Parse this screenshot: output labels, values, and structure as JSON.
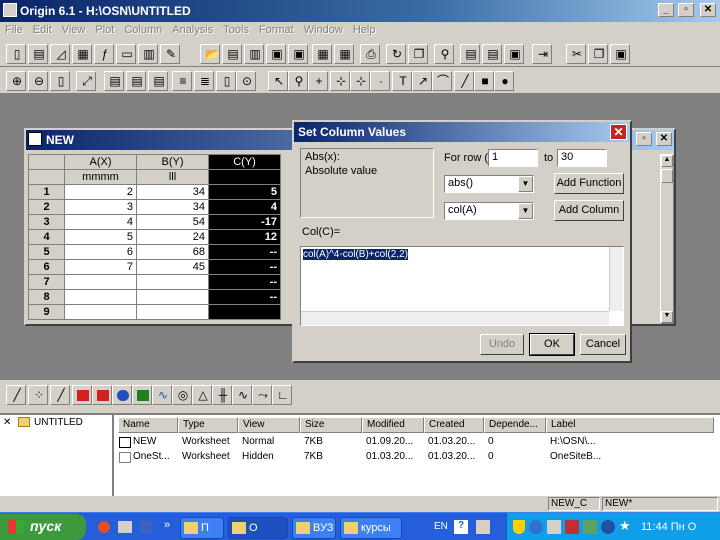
{
  "window": {
    "title": "Origin 6.1 - H:\\OSN\\UNTITLED"
  },
  "menu": [
    "File",
    "Edit",
    "View",
    "Plot",
    "Column",
    "Analysis",
    "Tools",
    "Format",
    "Window",
    "Help"
  ],
  "worksheet": {
    "title": "NEW",
    "columns": [
      {
        "name": "A(X)",
        "sub": "mmmm"
      },
      {
        "name": "B(Y)",
        "sub": "lll"
      },
      {
        "name": "C(Y)",
        "sub": ""
      }
    ],
    "rows": [
      {
        "n": "1",
        "a": "2",
        "b": "34",
        "c": "5"
      },
      {
        "n": "2",
        "a": "3",
        "b": "34",
        "c": "4"
      },
      {
        "n": "3",
        "a": "4",
        "b": "54",
        "c": "-17"
      },
      {
        "n": "4",
        "a": "5",
        "b": "24",
        "c": "12"
      },
      {
        "n": "5",
        "a": "6",
        "b": "68",
        "c": "--"
      },
      {
        "n": "6",
        "a": "7",
        "b": "45",
        "c": "--"
      },
      {
        "n": "7",
        "a": "",
        "b": "",
        "c": "--"
      },
      {
        "n": "8",
        "a": "",
        "b": "",
        "c": "--"
      },
      {
        "n": "9",
        "a": "",
        "b": "",
        "c": ""
      }
    ]
  },
  "dialog": {
    "title": "Set Column Values",
    "func_name": "Abs(x):",
    "func_desc": "Absolute value",
    "for_row_label": "For row (i)",
    "from_value": "1",
    "to_label": "to",
    "to_value": "30",
    "func_select": "abs()",
    "col_select": "col(A)",
    "add_function": "Add Function",
    "add_column": "Add Column",
    "col_label": "Col(C)=",
    "formula": "col(A)^4-col(B)+col(2,2)",
    "undo": "Undo",
    "ok": "OK",
    "cancel": "Cancel"
  },
  "explorer": {
    "folder": "UNTITLED",
    "headers": [
      "Name",
      "Type",
      "View",
      "Size",
      "Modified",
      "Created",
      "Depende...",
      "Label"
    ],
    "rows": [
      [
        "NEW",
        "Worksheet",
        "Normal",
        "7KB",
        "01.09.20...",
        "01.03.20...",
        "0",
        "H:\\OSN\\..."
      ],
      [
        "OneSt...",
        "Worksheet",
        "Hidden",
        "7KB",
        "01.03.20...",
        "01.03.20...",
        "0",
        "OneSiteB..."
      ]
    ]
  },
  "status": {
    "left": "NEW_C",
    "right": "NEW*"
  },
  "taskbar": {
    "start": "пуск",
    "tasks": [
      "П",
      "О",
      "ВУЗ",
      "курсы"
    ],
    "lang": "EN",
    "clock": "11:44  Пн О"
  }
}
